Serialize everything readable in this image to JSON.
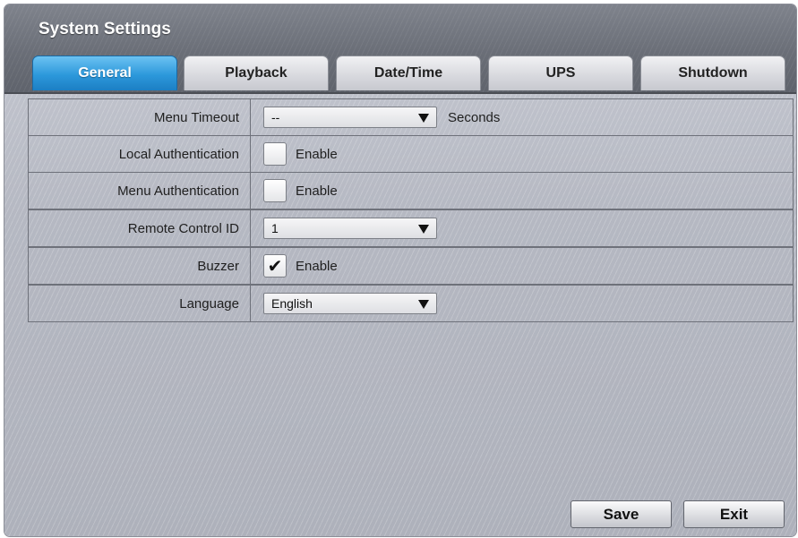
{
  "window": {
    "title": "System Settings"
  },
  "tabs": [
    {
      "label": "General",
      "active": true
    },
    {
      "label": "Playback",
      "active": false
    },
    {
      "label": "Date/Time",
      "active": false
    },
    {
      "label": "UPS",
      "active": false
    },
    {
      "label": "Shutdown",
      "active": false
    }
  ],
  "settings": {
    "menu_timeout": {
      "label": "Menu Timeout",
      "value": "--",
      "suffix": "Seconds"
    },
    "local_auth": {
      "label": "Local Authentication",
      "checked": false,
      "option": "Enable"
    },
    "menu_auth": {
      "label": "Menu Authentication",
      "checked": false,
      "option": "Enable"
    },
    "remote_id": {
      "label": "Remote Control ID",
      "value": "1"
    },
    "buzzer": {
      "label": "Buzzer",
      "checked": true,
      "option": "Enable",
      "check_glyph": "✔"
    },
    "language": {
      "label": "Language",
      "value": "English"
    }
  },
  "buttons": {
    "save": "Save",
    "exit": "Exit"
  },
  "colors": {
    "active_tab": "#2c98db",
    "title_bar": "#6a6e77"
  }
}
